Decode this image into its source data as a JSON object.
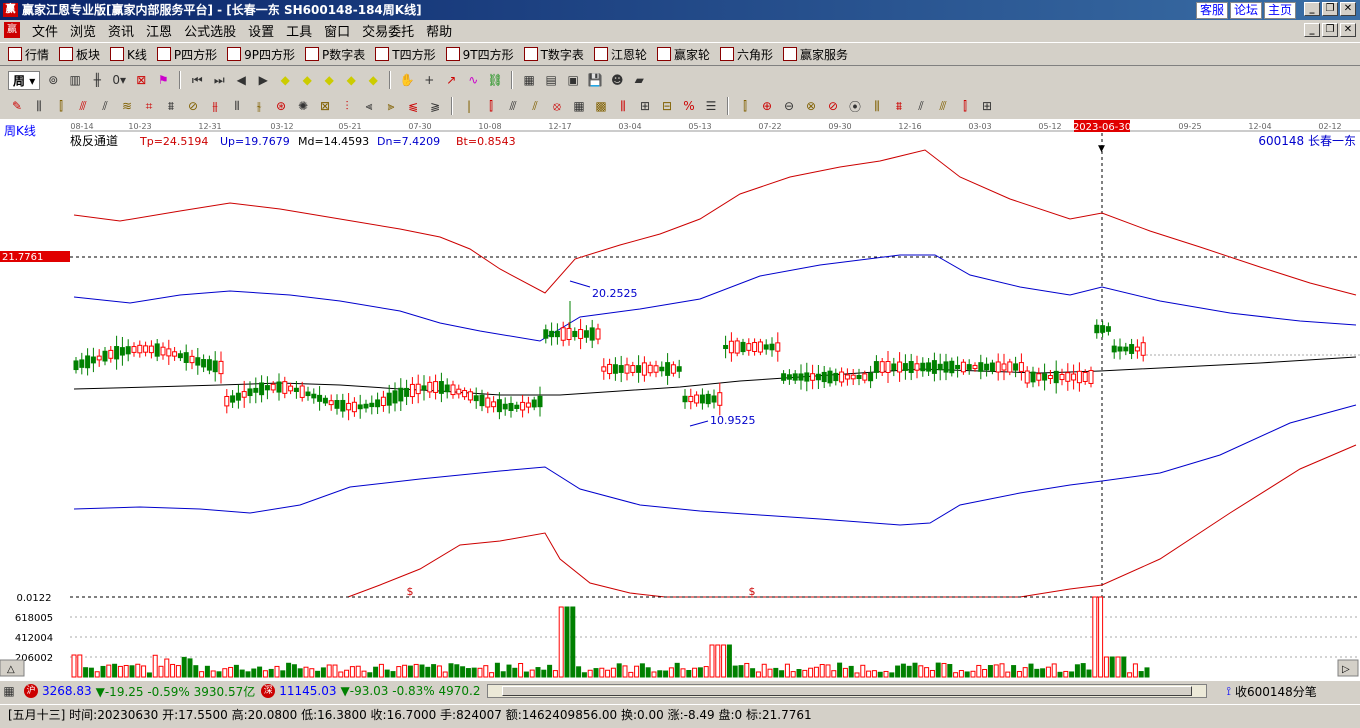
{
  "window": {
    "title": "赢家江恩专业版[赢家内部服务平台] - [长春一东  SH600148-184周K线]",
    "logo": "赢",
    "links": [
      "客服",
      "论坛",
      "主页"
    ]
  },
  "menu": [
    "文件",
    "浏览",
    "资讯",
    "江恩",
    "公式选股",
    "设置",
    "工具",
    "窗口",
    "交易委托",
    "帮助"
  ],
  "toolbar1": [
    {
      "icon": "table-icon",
      "label": "行情"
    },
    {
      "icon": "grid-icon",
      "label": "板块"
    },
    {
      "icon": "candle-icon",
      "label": "K线"
    },
    {
      "icon": "ps-icon",
      "label": "P四方形"
    },
    {
      "icon": "p9-icon",
      "label": "9P四方形"
    },
    {
      "icon": "pn-icon",
      "label": "P数字表"
    },
    {
      "icon": "ts-icon",
      "label": "T四方形"
    },
    {
      "icon": "t9-icon",
      "label": "9T四方形"
    },
    {
      "icon": "tn-icon",
      "label": "T数字表"
    },
    {
      "icon": "wheel-icon",
      "label": "江恩轮"
    },
    {
      "icon": "wheel2-icon",
      "label": "赢家轮"
    },
    {
      "icon": "hex-icon",
      "label": "六角形"
    },
    {
      "icon": "dollar-icon",
      "label": "赢家服务"
    }
  ],
  "toolbar2": {
    "period": "周"
  },
  "chart": {
    "period_label": "周K线",
    "indicator_name": "极反通道",
    "params": {
      "tp": "Tp=24.5194",
      "up": "Up=19.7679",
      "md": "Md=14.4593",
      "dn": "Dn=7.4209",
      "bt": "Bt=0.8543"
    },
    "stock_tag": "600148  长春一东",
    "price_marker": "21.7761",
    "high_label": "20.2525",
    "low_label": "10.9525",
    "selected_date": "2023-06-30",
    "date_ticks": [
      "08-14",
      "10-23",
      "12-31",
      "03-12",
      "05-21",
      "07-30",
      "10-08",
      "12-17",
      "03-04",
      "05-13",
      "07-22",
      "09-30",
      "12-16",
      "03-03",
      "05-12",
      "2023-06-30",
      "09-25",
      "12-04",
      "02-12"
    ],
    "volume_labels": [
      "0.0122",
      "618005",
      "412004",
      "206002"
    ],
    "dollar_marks": [
      "$",
      "$"
    ],
    "colors": {
      "up": "#ff0000",
      "down": "#008000",
      "upper": "#0000cc",
      "outer": "#cc0000",
      "mid": "#000000"
    }
  },
  "chart_data": {
    "type": "candlestick",
    "title": "周K线",
    "indicator": "极反通道",
    "x_ticks": [
      "08-14",
      "10-23",
      "12-31",
      "03-12",
      "05-21",
      "07-30",
      "10-08",
      "12-17",
      "03-04",
      "05-13",
      "07-22",
      "09-30",
      "12-16",
      "03-03",
      "05-12",
      "2023-06-30",
      "09-25",
      "12-04",
      "02-12"
    ],
    "annotations": {
      "high": 20.2525,
      "low": 10.9525,
      "marker_price": 21.7761
    },
    "volume_axis": [
      0.0122,
      618005,
      412004,
      206002
    ]
  },
  "status": {
    "sh_badge": "沪",
    "sh_text": "3268.83",
    "sh_change": "▼-19.25 -0.59% 3930.57亿",
    "sz_badge": "深",
    "sz_text": "11145.03",
    "sz_change": "▼-93.03 -0.83% 4970.2",
    "right": "收600148分笔"
  },
  "info": "[五月十三] 时间:20230630 开:17.5500 高:20.0800 低:16.3800 收:16.7000 手:824007 额:1462409856.00 换:0.00 涨:-8.49 盘:0 标:21.7761"
}
